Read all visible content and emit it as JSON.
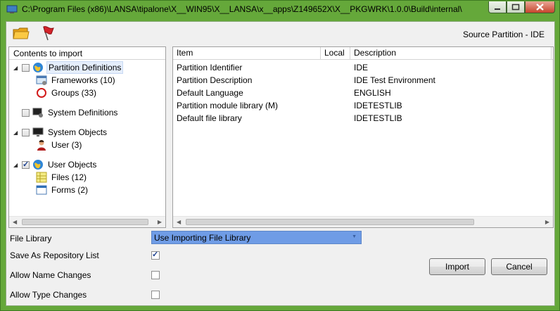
{
  "window": {
    "title": "C:\\Program Files (x86)\\LANSA\\tipalone\\X__WIN95\\X__LANSA\\x__apps\\Z149652X\\X__PKGWRK\\1.0.0\\Build\\internal\\"
  },
  "toolbar": {
    "open_icon": "folder-icon",
    "flag_icon": "red-flag-icon",
    "source_partition": "Source Partition - IDE"
  },
  "tree": {
    "header": "Contents to import",
    "groups": [
      {
        "label": "Partition Definitions",
        "checked": false,
        "icon": "globe-icon",
        "children": [
          {
            "label": "Frameworks (10)",
            "icon": "framework-icon"
          },
          {
            "label": "Groups (33)",
            "icon": "group-ring-icon"
          }
        ]
      },
      {
        "label": "System Definitions",
        "checked": false,
        "icon": "computer-gear-icon",
        "children": []
      },
      {
        "label": "System Objects",
        "checked": false,
        "icon": "monitor-icon",
        "children": [
          {
            "label": "User (3)",
            "icon": "user-icon"
          }
        ]
      },
      {
        "label": "User Objects",
        "checked": true,
        "icon": "globe-icon",
        "children": [
          {
            "label": "Files (12)",
            "icon": "file-grid-icon"
          },
          {
            "label": "Forms (2)",
            "icon": "form-icon"
          }
        ]
      }
    ]
  },
  "list": {
    "columns": [
      "Item",
      "Local",
      "Description"
    ],
    "rows": [
      {
        "item": "Partition Identifier",
        "local": "",
        "description": "IDE"
      },
      {
        "item": "Partition Description",
        "local": "",
        "description": "IDE Test Environment"
      },
      {
        "item": "Default Language",
        "local": "",
        "description": "ENGLISH"
      },
      {
        "item": "Partition module library (M)",
        "local": "",
        "description": "IDETESTLIB"
      },
      {
        "item": "Default file library",
        "local": "",
        "description": "IDETESTLIB"
      }
    ]
  },
  "form": {
    "file_library_label": "File Library",
    "file_library_value": "Use Importing File Library",
    "save_as_repo_label": "Save As Repository List",
    "save_as_repo_checked": true,
    "allow_name_label": "Allow Name Changes",
    "allow_name_checked": false,
    "allow_type_label": "Allow Type Changes",
    "allow_type_checked": false
  },
  "buttons": {
    "import": "Import",
    "cancel": "Cancel"
  },
  "colors": {
    "frame": "#65a83a",
    "selection": "#6f9ce6"
  }
}
